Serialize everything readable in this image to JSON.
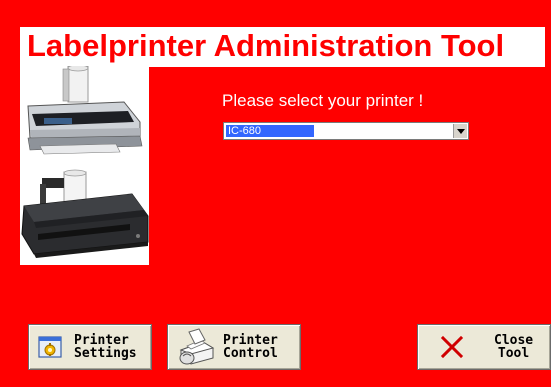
{
  "window": {
    "title": "Labelprinter Administration Tool"
  },
  "main": {
    "prompt": "Please select your printer !",
    "printer_select": {
      "selected": "IC-680"
    }
  },
  "buttons": {
    "settings": {
      "line1": "Printer",
      "line2": "Settings",
      "icon": "printer-settings-icon"
    },
    "control": {
      "line1": "Printer",
      "line2": "Control",
      "icon": "printer-control-icon"
    },
    "close": {
      "line1": "Close",
      "line2": "Tool",
      "icon": "close-x-icon"
    }
  },
  "colors": {
    "background": "#ff0000",
    "title_text": "#ff0000",
    "title_background": "#ffffff",
    "selection": "#3366ff",
    "button_face": "#ece9d8"
  }
}
